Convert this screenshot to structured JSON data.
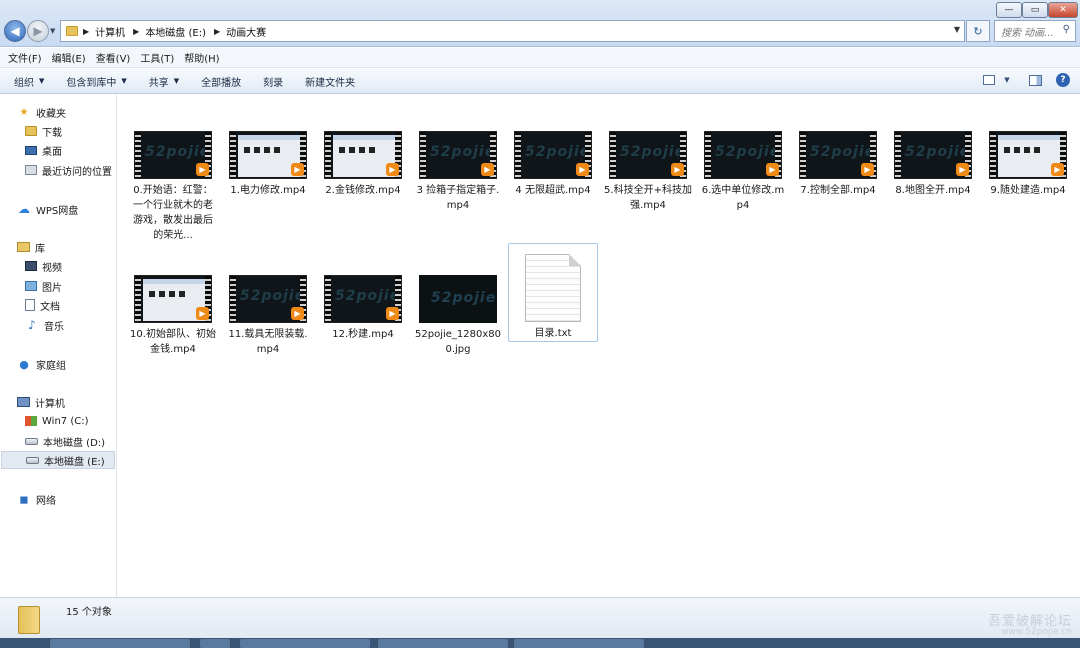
{
  "address": {
    "crumbs": [
      "计算机",
      "本地磁盘 (E:)",
      "动画大赛"
    ],
    "search_placeholder": "搜索 动画..."
  },
  "menu": [
    "文件(F)",
    "编辑(E)",
    "查看(V)",
    "工具(T)",
    "帮助(H)"
  ],
  "commands": [
    {
      "label": "组织",
      "dropdown": true
    },
    {
      "label": "包含到库中",
      "dropdown": true
    },
    {
      "label": "共享",
      "dropdown": true
    },
    {
      "label": "全部播放",
      "dropdown": false
    },
    {
      "label": "刻录",
      "dropdown": false
    },
    {
      "label": "新建文件夹",
      "dropdown": false
    }
  ],
  "nav": {
    "favorites": "收藏夹",
    "downloads": "下载",
    "desktop": "桌面",
    "recent": "最近访问的位置",
    "wps": "WPS网盘",
    "libraries": "库",
    "videos": "视频",
    "pictures": "图片",
    "documents": "文档",
    "music": "音乐",
    "homegroup": "家庭组",
    "computer": "计算机",
    "drive_c": "Win7 (C:)",
    "drive_d": "本地磁盘 (D:)",
    "drive_e": "本地磁盘 (E:)",
    "network": "网络"
  },
  "files": [
    {
      "name": "0.开始语：红警：一个行业就木的老游戏，散发出最后的荣光...",
      "kind": "video-dark"
    },
    {
      "name": "1.电力修改.mp4",
      "kind": "video-screen"
    },
    {
      "name": "2.金钱修改.mp4",
      "kind": "video-screen"
    },
    {
      "name": "3 捡箱子指定箱子.mp4",
      "kind": "video-dark"
    },
    {
      "name": "4 无限超武.mp4",
      "kind": "video-dark"
    },
    {
      "name": "5.科技全开+科技加强.mp4",
      "kind": "video-dark"
    },
    {
      "name": "6.选中单位修改.mp4",
      "kind": "video-dark"
    },
    {
      "name": "7.控制全部.mp4",
      "kind": "video-dark"
    },
    {
      "name": "8.地图全开.mp4",
      "kind": "video-dark"
    },
    {
      "name": "9.随处建造.mp4",
      "kind": "video-screen"
    },
    {
      "name": "10.初始部队、初始金钱.mp4",
      "kind": "video-screen"
    },
    {
      "name": "11.载具无限装载.mp4",
      "kind": "video-dark"
    },
    {
      "name": "12.秒建.mp4",
      "kind": "video-dark"
    },
    {
      "name": "52pojie_1280x800.jpg",
      "kind": "jpg"
    },
    {
      "name": "目录.txt",
      "kind": "txt"
    }
  ],
  "logo_text": "52pojie",
  "status": {
    "count": "15 个对象"
  },
  "watermark": {
    "line1": "吾爱破解论坛",
    "line2": "www.52pojie.cn"
  }
}
